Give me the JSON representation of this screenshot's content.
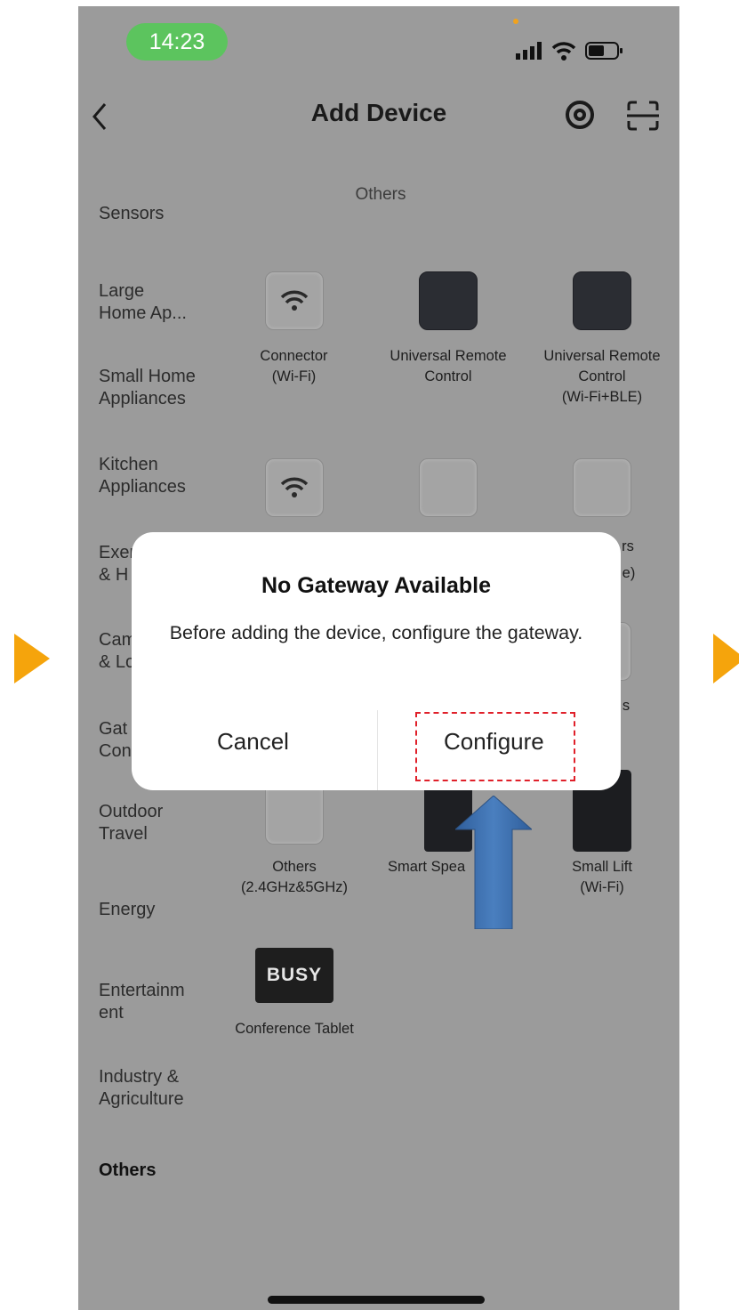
{
  "status_bar": {
    "time": "14:23"
  },
  "nav": {
    "title": "Add Device"
  },
  "sidebar": {
    "items": [
      {
        "label": "Sensors"
      },
      {
        "label": "Large\nHome Ap..."
      },
      {
        "label": "Small Home\nAppliances"
      },
      {
        "label": "Kitchen\nAppliances"
      },
      {
        "label": "Exer\n& H"
      },
      {
        "label": "Cam\n& Lo"
      },
      {
        "label": "Gat\nCon"
      },
      {
        "label": "Outdoor\nTravel"
      },
      {
        "label": "Energy"
      },
      {
        "label": "Entertainm\nent"
      },
      {
        "label": "Industry &\nAgriculture"
      },
      {
        "label": "Others"
      }
    ]
  },
  "section": {
    "title": "Others"
  },
  "devices": [
    {
      "label": "Connector\n(Wi-Fi)",
      "icon": "wifi-icon"
    },
    {
      "label": "Universal Remote\nControl",
      "icon": "remote-icon"
    },
    {
      "label": "Universal Remote\nControl\n(Wi-Fi+BLE)",
      "icon": "remote-icon"
    },
    {
      "label": "rs",
      "icon": "wifi-icon"
    },
    {
      "label": "e)",
      "icon": "device-icon"
    },
    {
      "label": "s",
      "icon": "device-icon"
    },
    {
      "label": "Others\n(2.4GHz&5GHz)",
      "icon": "device-icon"
    },
    {
      "label": "Smart Spea",
      "icon": "speaker-icon"
    },
    {
      "label": "Small Lift\n(Wi-Fi)",
      "icon": "lift-icon"
    },
    {
      "label": "Conference Tablet",
      "icon": "tablet-icon",
      "badge": "BUSY"
    }
  ],
  "dialog": {
    "title": "No Gateway Available",
    "message": "Before adding the device, configure the gateway.",
    "cancel": "Cancel",
    "confirm": "Configure"
  },
  "colors": {
    "status_pill": "#5cc45e",
    "overlay": "#9b9b9b",
    "highlight": "#e0202a",
    "pointer_arrow": "#3b6aa8",
    "step_arrow": "#f5a40c"
  }
}
